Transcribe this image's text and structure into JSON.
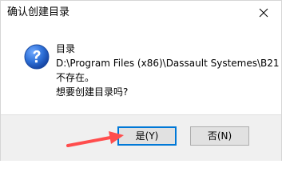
{
  "window": {
    "title": "确认创建目录"
  },
  "message": {
    "line1": "目录",
    "line2": "D:\\Program Files (x86)\\Dassault Systemes\\B21",
    "line3": "不存在。",
    "line4": "想要创建目录吗?"
  },
  "buttons": {
    "yes_label": "是(Y)",
    "no_label": "否(N)"
  },
  "icons": {
    "question": "question-icon",
    "close": "close-icon",
    "annotation_arrow": "red-arrow"
  },
  "colors": {
    "question_icon": "#1f5fbf",
    "focus_border": "#0078d7",
    "annotation_arrow": "#ff4d4d"
  }
}
